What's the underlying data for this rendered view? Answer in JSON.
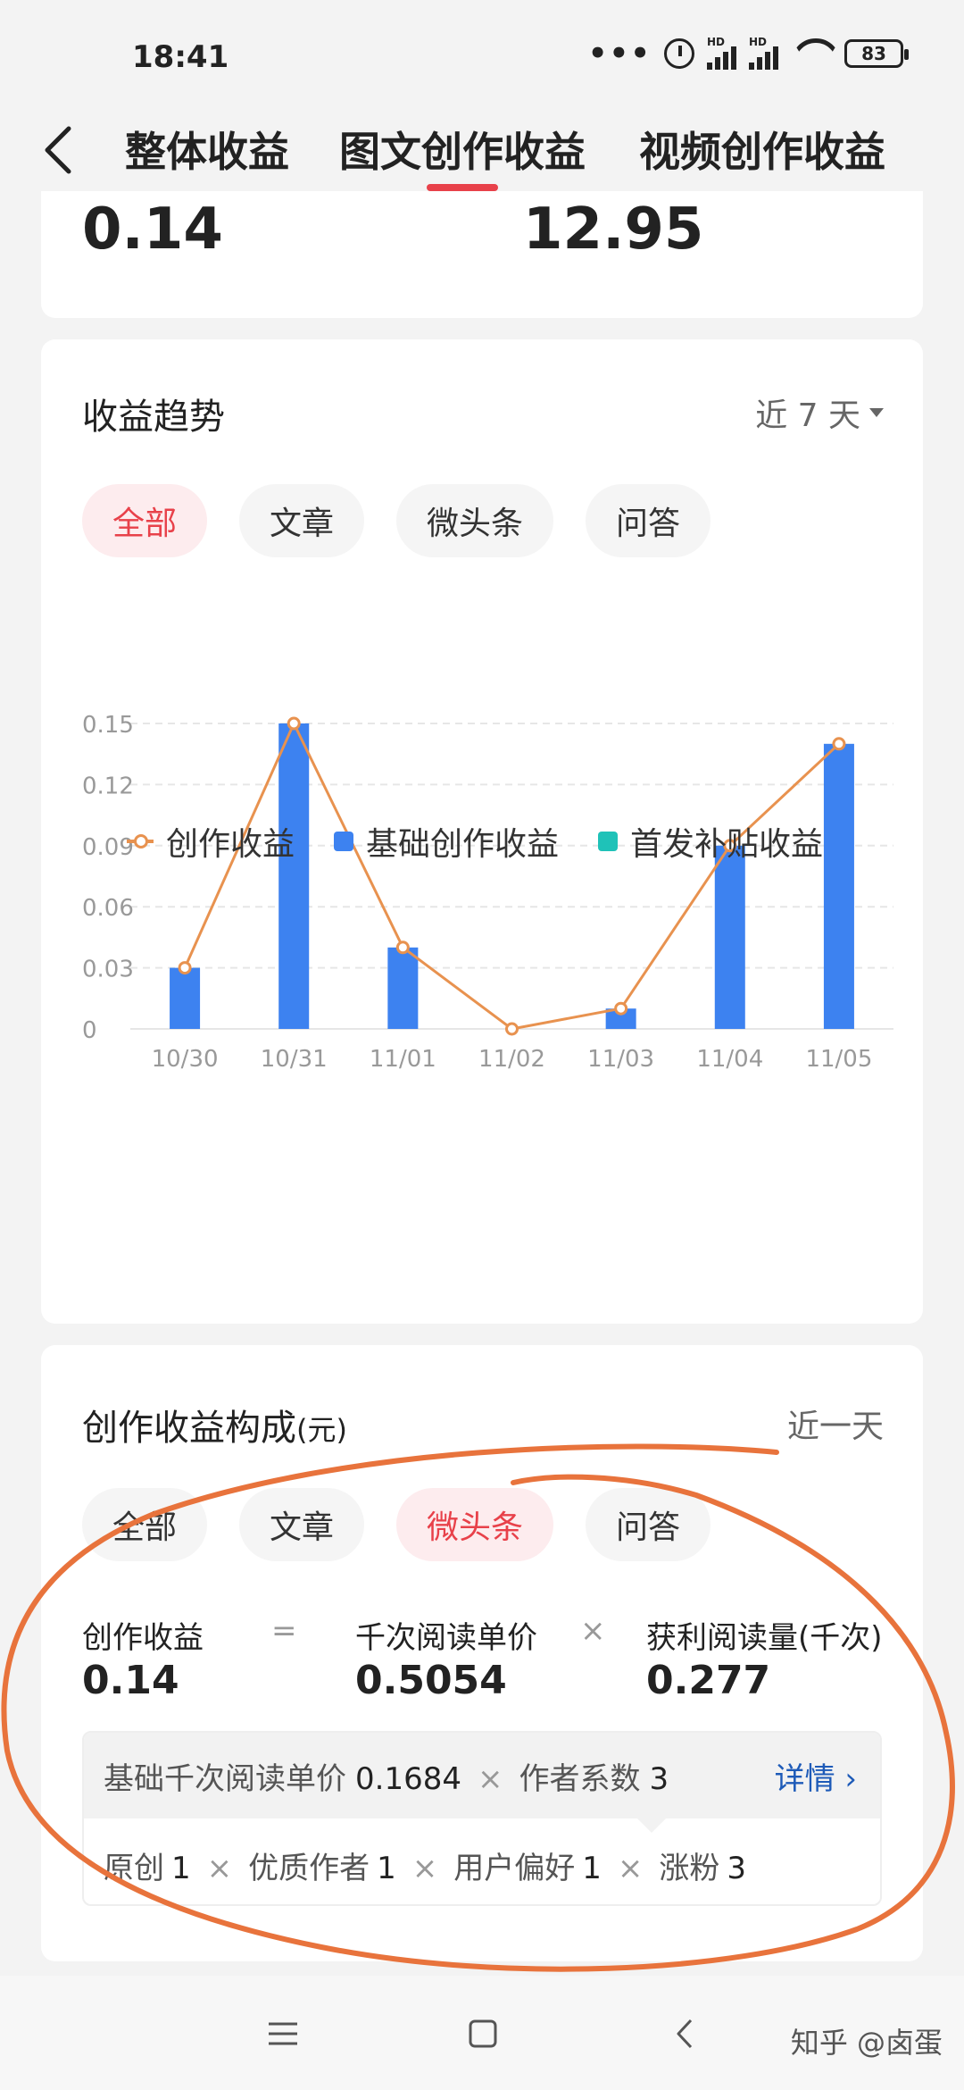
{
  "status_bar": {
    "time": "18:41",
    "battery": "83",
    "signal_labels": [
      "HD",
      "HD"
    ]
  },
  "tabs": [
    {
      "label": "整体收益",
      "active": false
    },
    {
      "label": "图文创作收益",
      "active": true
    },
    {
      "label": "视频创作收益",
      "active": false
    }
  ],
  "summary": {
    "value_1": "0.14",
    "value_2": "12.95"
  },
  "trend": {
    "title": "收益趋势",
    "range": "近 7 天",
    "filters": [
      {
        "label": "全部",
        "active": true
      },
      {
        "label": "文章",
        "active": false
      },
      {
        "label": "微头条",
        "active": false
      },
      {
        "label": "问答",
        "active": false
      }
    ],
    "legend": [
      {
        "label": "创作收益",
        "color": "#e8924f"
      },
      {
        "label": "基础创作收益",
        "color": "#3d82f0"
      },
      {
        "label": "首发补贴收益",
        "color": "#1fc2b8"
      }
    ]
  },
  "chart_data": {
    "type": "bar",
    "categories": [
      "10/30",
      "10/31",
      "11/01",
      "11/02",
      "11/03",
      "11/04",
      "11/05"
    ],
    "series": [
      {
        "name": "基础创作收益",
        "type": "bar",
        "values": [
          0.03,
          0.15,
          0.04,
          0,
          0.01,
          0.09,
          0.14
        ],
        "color": "#3d82f0"
      },
      {
        "name": "创作收益",
        "type": "line",
        "values": [
          0.03,
          0.15,
          0.04,
          0,
          0.01,
          0.09,
          0.14
        ],
        "color": "#e8924f"
      }
    ],
    "yticks": [
      "0",
      "0.03",
      "0.06",
      "0.09",
      "0.12",
      "0.15"
    ],
    "ylim": [
      0,
      0.15
    ],
    "grid": true,
    "legend_position": "bottom"
  },
  "composition": {
    "title": "创作收益构成",
    "unit": "(元)",
    "range": "近一天",
    "filters": [
      {
        "label": "全部",
        "active": false
      },
      {
        "label": "文章",
        "active": false
      },
      {
        "label": "微头条",
        "active": true
      },
      {
        "label": "问答",
        "active": false
      }
    ],
    "formula": {
      "a_label": "创作收益",
      "a_value": "0.14",
      "op1": "=",
      "b_label": "千次阅读单价",
      "b_value": "0.5054",
      "op2": "×",
      "c_label": "获利阅读量(千次)",
      "c_value": "0.277"
    },
    "detail": {
      "base_label": "基础千次阅读单价",
      "base_value": "0.1684",
      "times": "×",
      "coef_label": "作者系数",
      "coef_value": "3",
      "link": "详情",
      "factors": [
        {
          "label": "原创",
          "value": "1"
        },
        {
          "label": "优质作者",
          "value": "1"
        },
        {
          "label": "用户偏好",
          "value": "1"
        },
        {
          "label": "涨粉",
          "value": "3"
        }
      ]
    }
  },
  "watermark": "知乎 @卤蛋"
}
